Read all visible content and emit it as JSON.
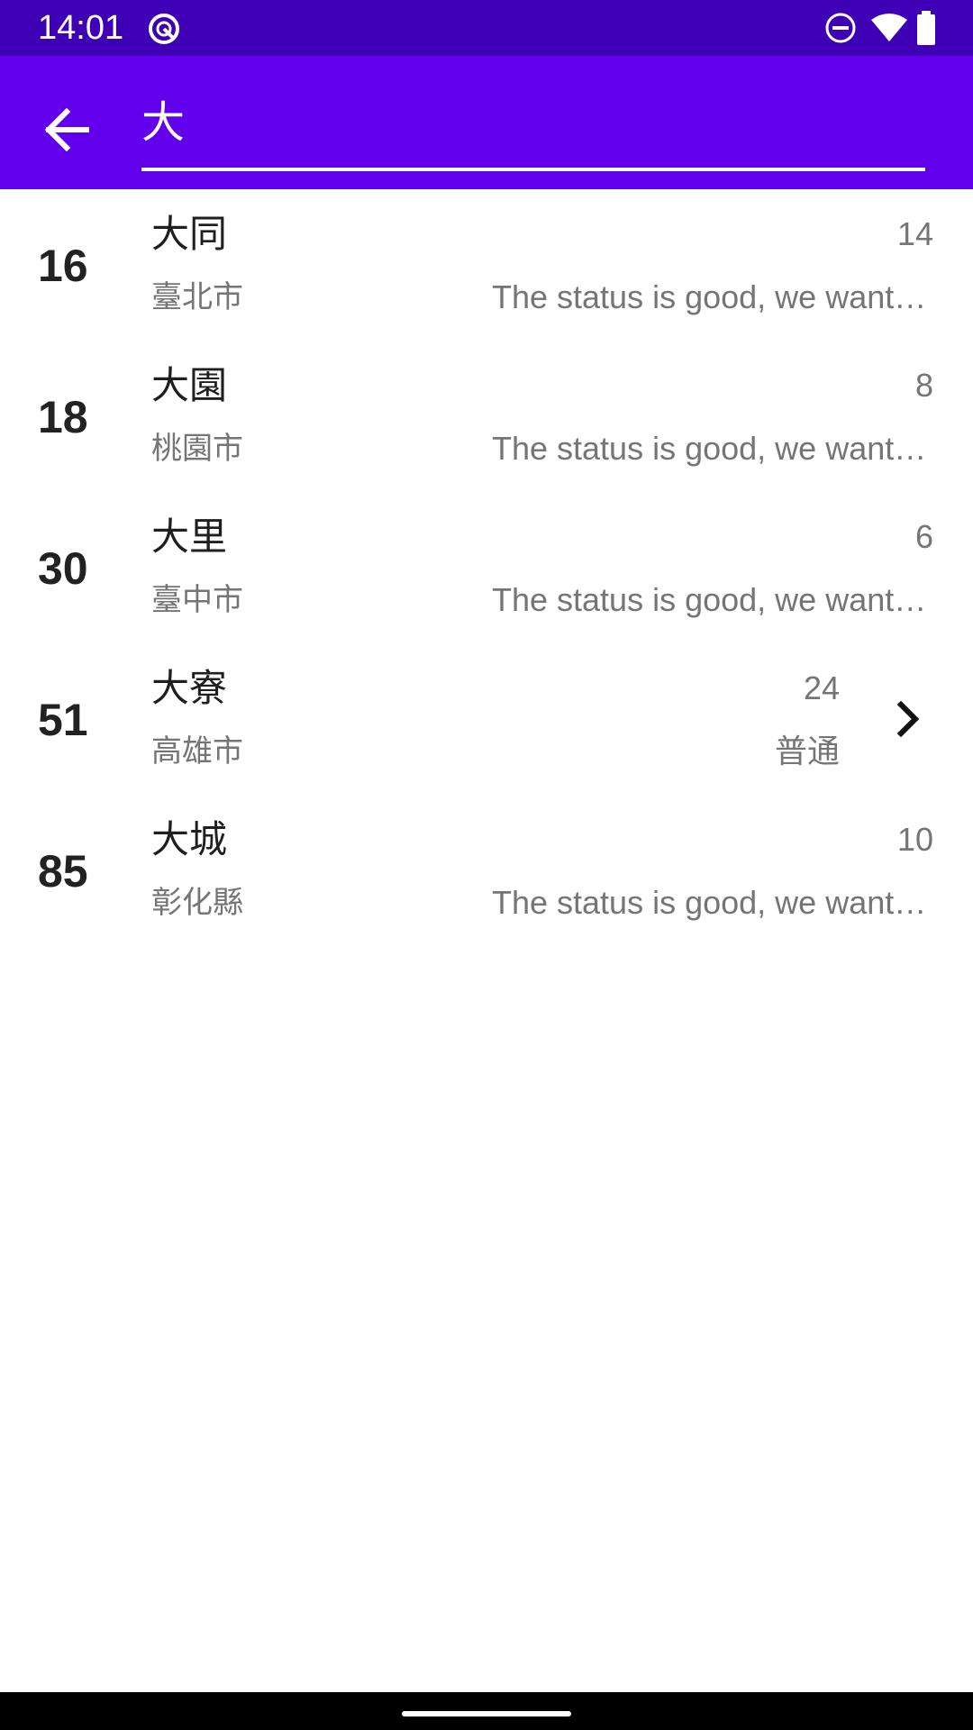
{
  "status_bar": {
    "time": "14:01",
    "icons": [
      "sync-icon",
      "do-not-disturb-icon",
      "wifi-icon",
      "battery-icon"
    ]
  },
  "app_bar": {
    "back_icon": "arrow-back-icon",
    "search_value": "大"
  },
  "results": [
    {
      "index": "16",
      "name": "大同",
      "city": "臺北市",
      "count": "14",
      "status": "The status is good, we want to go there"
    },
    {
      "index": "18",
      "name": "大園",
      "city": "桃園市",
      "count": "8",
      "status": "The status is good, we want to go there"
    },
    {
      "index": "30",
      "name": "大里",
      "city": "臺中市",
      "count": "6",
      "status": "The status is good, we want to go there"
    },
    {
      "index": "51",
      "name": "大寮",
      "city": "高雄市",
      "count": "24",
      "status": "普通",
      "chevron_icon": "chevron-right-icon"
    },
    {
      "index": "85",
      "name": "大城",
      "city": "彰化縣",
      "count": "10",
      "status": "The status is good, we want to go there"
    }
  ],
  "colors": {
    "status_bar": "#3f00b5",
    "app_bar": "#6200ee",
    "primary_text": "#1f1f1f",
    "secondary_text": "#757575"
  }
}
